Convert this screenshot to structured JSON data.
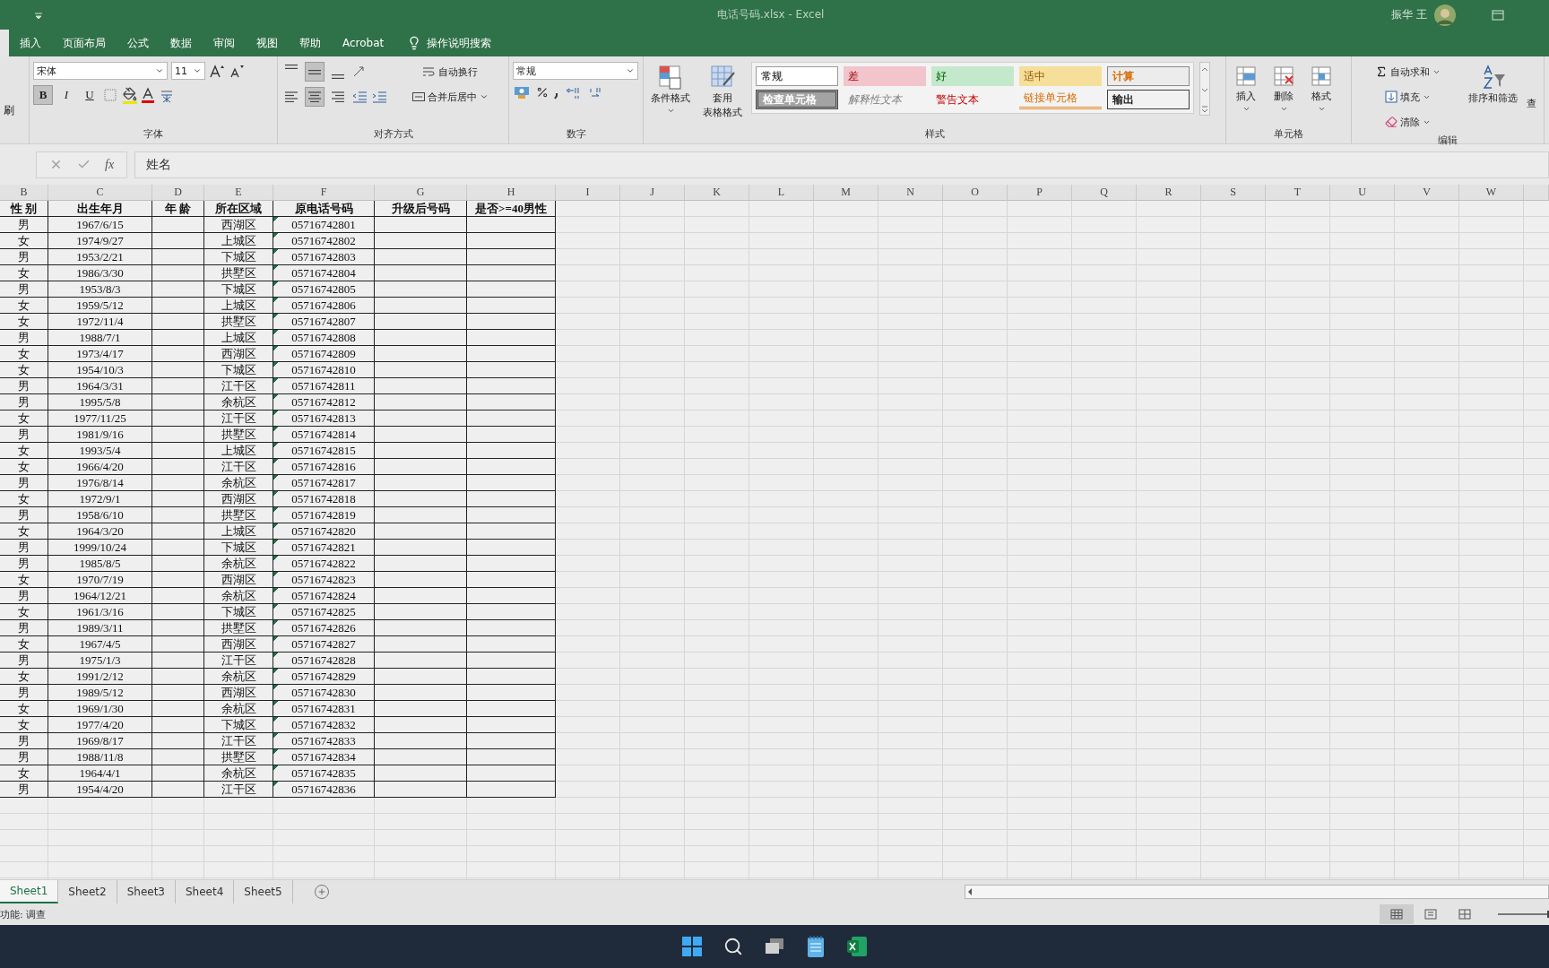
{
  "title_bar": {
    "title": "电话号码.xlsx  -  Excel",
    "user": "振华 王"
  },
  "ribbon_tabs": [
    {
      "selected": true
    },
    {
      "label": "插入",
      "selected": false
    },
    {
      "label": "页面布局",
      "selected": false
    },
    {
      "label": "公式",
      "selected": false
    },
    {
      "label": "数据",
      "selected": false
    },
    {
      "label": "审阅",
      "selected": false
    },
    {
      "label": "视图",
      "selected": false
    },
    {
      "label": "帮助",
      "selected": false
    },
    {
      "label": "Acrobat",
      "selected": false
    }
  ],
  "tell_me": "操作说明搜索",
  "clipboard": {
    "label": "刷"
  },
  "font_group": {
    "label": "字体",
    "font": "宋体",
    "size": "11",
    "bold_label": "B",
    "italic_label": "I",
    "underline_label": "U",
    "bold": true,
    "italic": false,
    "underline": false
  },
  "alignment_group": {
    "label": "对齐方式",
    "wrap": "自动换行",
    "merge": "合并后居中",
    "vertical": [
      {
        "selected": false
      },
      {
        "selected": true
      },
      {
        "selected": false
      }
    ],
    "horizontal": [
      {
        "selected": false
      },
      {
        "selected": true
      },
      {
        "selected": false
      }
    ]
  },
  "number_group": {
    "label": "数字",
    "format": "常规"
  },
  "styles_group": {
    "label": "样式",
    "conditional": "条件格式",
    "table_format": [
      "套用",
      "表格格式"
    ],
    "cell_styles": [
      {
        "kind": "normal",
        "label": "常规"
      },
      {
        "kind": "bad",
        "label": "差"
      },
      {
        "kind": "good",
        "label": "好"
      },
      {
        "kind": "neutral",
        "label": "适中"
      },
      {
        "kind": "calculation",
        "label": "计算"
      },
      {
        "kind": "check",
        "label": "检查单元格"
      },
      {
        "kind": "explanatory",
        "label": "解释性文本"
      },
      {
        "kind": "warning",
        "label": "警告文本"
      },
      {
        "kind": "linked",
        "label": "链接单元格"
      },
      {
        "kind": "output",
        "label": "输出"
      }
    ]
  },
  "cells_group": {
    "label": "单元格",
    "buttons": [
      "插入",
      "删除",
      "格式"
    ]
  },
  "editing_group": {
    "label": "编辑",
    "autosum": "自动求和",
    "fill": "填充",
    "clear": "清除",
    "sort": "排序和筛选",
    "find": "查"
  },
  "formula_bar": {
    "function_label": "fx",
    "value": "姓名"
  },
  "sheet": {
    "columns": [
      "B",
      "C",
      "D",
      "E",
      "F",
      "G",
      "H",
      "I",
      "J",
      "K",
      "L",
      "M",
      "N",
      "O",
      "P",
      "Q",
      "R",
      "S",
      "T",
      "U",
      "V",
      "W"
    ],
    "header": [
      "性  别",
      "出生年月",
      "年  龄",
      "所在区域",
      "原电话号码",
      "升级后号码",
      "是否>=40男性"
    ],
    "rows": [
      [
        "男",
        "1967/6/15",
        "",
        "西湖区",
        "05716742801",
        "",
        ""
      ],
      [
        "女",
        "1974/9/27",
        "",
        "上城区",
        "05716742802",
        "",
        ""
      ],
      [
        "男",
        "1953/2/21",
        "",
        "下城区",
        "05716742803",
        "",
        ""
      ],
      [
        "女",
        "1986/3/30",
        "",
        "拱墅区",
        "05716742804",
        "",
        ""
      ],
      [
        "男",
        "1953/8/3",
        "",
        "下城区",
        "05716742805",
        "",
        ""
      ],
      [
        "女",
        "1959/5/12",
        "",
        "上城区",
        "05716742806",
        "",
        ""
      ],
      [
        "女",
        "1972/11/4",
        "",
        "拱墅区",
        "05716742807",
        "",
        ""
      ],
      [
        "男",
        "1988/7/1",
        "",
        "上城区",
        "05716742808",
        "",
        ""
      ],
      [
        "女",
        "1973/4/17",
        "",
        "西湖区",
        "05716742809",
        "",
        ""
      ],
      [
        "女",
        "1954/10/3",
        "",
        "下城区",
        "05716742810",
        "",
        ""
      ],
      [
        "男",
        "1964/3/31",
        "",
        "江干区",
        "05716742811",
        "",
        ""
      ],
      [
        "男",
        "1995/5/8",
        "",
        "余杭区",
        "05716742812",
        "",
        ""
      ],
      [
        "女",
        "1977/11/25",
        "",
        "江干区",
        "05716742813",
        "",
        ""
      ],
      [
        "男",
        "1981/9/16",
        "",
        "拱墅区",
        "05716742814",
        "",
        ""
      ],
      [
        "女",
        "1993/5/4",
        "",
        "上城区",
        "05716742815",
        "",
        ""
      ],
      [
        "女",
        "1966/4/20",
        "",
        "江干区",
        "05716742816",
        "",
        ""
      ],
      [
        "男",
        "1976/8/14",
        "",
        "余杭区",
        "05716742817",
        "",
        ""
      ],
      [
        "女",
        "1972/9/1",
        "",
        "西湖区",
        "05716742818",
        "",
        ""
      ],
      [
        "男",
        "1958/6/10",
        "",
        "拱墅区",
        "05716742819",
        "",
        ""
      ],
      [
        "女",
        "1964/3/20",
        "",
        "上城区",
        "05716742820",
        "",
        ""
      ],
      [
        "男",
        "1999/10/24",
        "",
        "下城区",
        "05716742821",
        "",
        ""
      ],
      [
        "男",
        "1985/8/5",
        "",
        "余杭区",
        "05716742822",
        "",
        ""
      ],
      [
        "女",
        "1970/7/19",
        "",
        "西湖区",
        "05716742823",
        "",
        ""
      ],
      [
        "男",
        "1964/12/21",
        "",
        "余杭区",
        "05716742824",
        "",
        ""
      ],
      [
        "女",
        "1961/3/16",
        "",
        "下城区",
        "05716742825",
        "",
        ""
      ],
      [
        "男",
        "1989/3/11",
        "",
        "拱墅区",
        "05716742826",
        "",
        ""
      ],
      [
        "女",
        "1967/4/5",
        "",
        "西湖区",
        "05716742827",
        "",
        ""
      ],
      [
        "男",
        "1975/1/3",
        "",
        "江干区",
        "05716742828",
        "",
        ""
      ],
      [
        "女",
        "1991/2/12",
        "",
        "余杭区",
        "05716742829",
        "",
        ""
      ],
      [
        "男",
        "1989/5/12",
        "",
        "西湖区",
        "05716742830",
        "",
        ""
      ],
      [
        "女",
        "1969/1/30",
        "",
        "余杭区",
        "05716742831",
        "",
        ""
      ],
      [
        "女",
        "1977/4/20",
        "",
        "下城区",
        "05716742832",
        "",
        ""
      ],
      [
        "男",
        "1969/8/17",
        "",
        "江干区",
        "05716742833",
        "",
        ""
      ],
      [
        "男",
        "1988/11/8",
        "",
        "拱墅区",
        "05716742834",
        "",
        ""
      ],
      [
        "女",
        "1964/4/1",
        "",
        "余杭区",
        "05716742835",
        "",
        ""
      ],
      [
        "男",
        "1954/4/20",
        "",
        "江干区",
        "05716742836",
        "",
        ""
      ]
    ]
  },
  "sheet_tabs": [
    {
      "label": "Sheet1",
      "selected": true
    },
    {
      "label": "Sheet2",
      "selected": false
    },
    {
      "label": "Sheet3",
      "selected": false
    },
    {
      "label": "Sheet4",
      "selected": false
    },
    {
      "label": "Sheet5",
      "selected": false
    }
  ],
  "status_bar": {
    "text": "功能: 调查",
    "view_modes": [
      {
        "selected": true
      },
      {
        "selected": false
      },
      {
        "selected": false
      }
    ],
    "zoom": {
      "level": 0.5
    }
  }
}
